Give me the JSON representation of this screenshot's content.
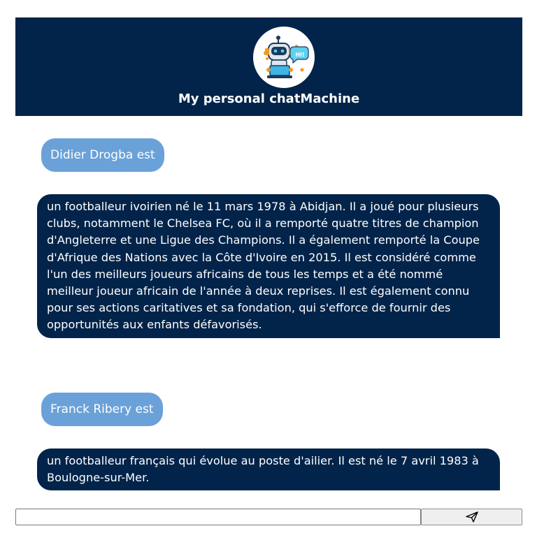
{
  "header": {
    "title": "My personal chatMachine",
    "logo_icon": "robot-mascot-icon",
    "logo_bubble_text": "HI!",
    "bg_color": "#03244a"
  },
  "messages": [
    {
      "role": "user",
      "text": "Didier Drogba est"
    },
    {
      "role": "bot",
      "text": "un footballeur ivoirien né le 11 mars 1978 à Abidjan. Il a joué pour plusieurs clubs, notamment le Chelsea FC, où il a remporté quatre titres de champion d'Angleterre et une Ligue des Champions. Il a également remporté la Coupe d'Afrique des Nations avec la Côte d'Ivoire en 2015. Il est considéré comme l'un des meilleurs joueurs africains de tous les temps et a été nommé meilleur joueur africain de l'année à deux reprises. Il est également connu pour ses actions caritatives et sa fondation, qui s'efforce de fournir des opportunités aux enfants défavorisés."
    },
    {
      "role": "user",
      "text": "Franck Ribery est"
    },
    {
      "role": "bot",
      "text": "un footballeur français qui évolue au poste d'ailier. Il est né le 7 avril 1983 à Boulogne-sur-Mer."
    }
  ],
  "composer": {
    "input_value": "",
    "placeholder": "",
    "send_icon": "paper-plane-icon"
  },
  "colors": {
    "user_bubble": "#6aa1d9",
    "bot_bubble": "#03244a"
  }
}
